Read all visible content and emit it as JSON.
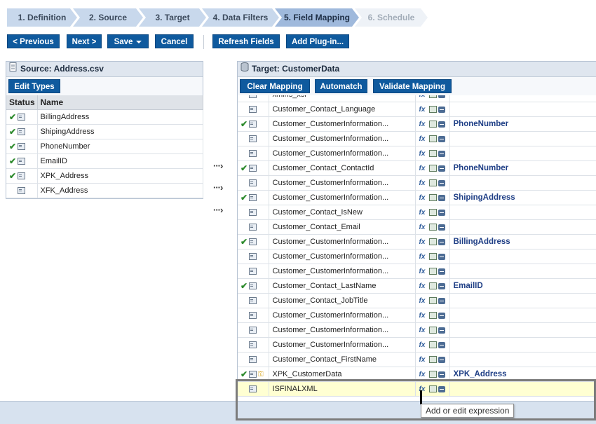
{
  "wizard": {
    "steps": [
      {
        "label": "1. Definition"
      },
      {
        "label": "2. Source"
      },
      {
        "label": "3. Target"
      },
      {
        "label": "4. Data Filters"
      },
      {
        "label": "5. Field Mapping"
      },
      {
        "label": "6. Schedule"
      }
    ],
    "active_step": "5. Field Mapping"
  },
  "toolbar": {
    "previous_label": "< Previous",
    "next_label": "Next >",
    "save_label": "Save",
    "cancel_label": "Cancel",
    "refresh_label": "Refresh Fields",
    "plugin_label": "Add Plug-in..."
  },
  "source": {
    "title": "Source: Address.csv",
    "edit_types_label": "Edit Types",
    "columns": {
      "status": "Status",
      "name": "Name"
    },
    "rows": [
      {
        "name": "BillingAddress",
        "mapped": true
      },
      {
        "name": "ShipingAddress",
        "mapped": true
      },
      {
        "name": "PhoneNumber",
        "mapped": true
      },
      {
        "name": "EmailID",
        "mapped": true
      },
      {
        "name": "XPK_Address",
        "mapped": true
      },
      {
        "name": "XFK_Address",
        "mapped": false
      }
    ]
  },
  "target": {
    "title": "Target: CustomerData",
    "clear_label": "Clear Mapping",
    "automatch_label": "Automatch",
    "validate_label": "Validate Mapping",
    "rows": [
      {
        "name": "xmlns_xsi",
        "mapped": "",
        "check": false
      },
      {
        "name": "Customer_Contact_Language",
        "mapped": "",
        "check": false
      },
      {
        "name": "Customer_CustomerInformation...",
        "mapped": "PhoneNumber",
        "check": true
      },
      {
        "name": "Customer_CustomerInformation...",
        "mapped": "",
        "check": false
      },
      {
        "name": "Customer_CustomerInformation...",
        "mapped": "",
        "check": false
      },
      {
        "name": "Customer_Contact_ContactId",
        "mapped": "PhoneNumber",
        "check": true
      },
      {
        "name": "Customer_CustomerInformation...",
        "mapped": "",
        "check": false
      },
      {
        "name": "Customer_CustomerInformation...",
        "mapped": "ShipingAddress",
        "check": true
      },
      {
        "name": "Customer_Contact_IsNew",
        "mapped": "",
        "check": false
      },
      {
        "name": "Customer_Contact_Email",
        "mapped": "",
        "check": false
      },
      {
        "name": "Customer_CustomerInformation...",
        "mapped": "BillingAddress",
        "check": true
      },
      {
        "name": "Customer_CustomerInformation...",
        "mapped": "",
        "check": false
      },
      {
        "name": "Customer_CustomerInformation...",
        "mapped": "",
        "check": false
      },
      {
        "name": "Customer_Contact_LastName",
        "mapped": "EmailID",
        "check": true
      },
      {
        "name": "Customer_Contact_JobTitle",
        "mapped": "",
        "check": false
      },
      {
        "name": "Customer_CustomerInformation...",
        "mapped": "",
        "check": false
      },
      {
        "name": "Customer_CustomerInformation...",
        "mapped": "",
        "check": false
      },
      {
        "name": "Customer_CustomerInformation...",
        "mapped": "",
        "check": false
      },
      {
        "name": "Customer_Contact_FirstName",
        "mapped": "",
        "check": false
      },
      {
        "name": "XPK_CustomerData",
        "mapped": "XPK_Address",
        "check": true,
        "key": true
      },
      {
        "name": "ISFINALXML",
        "mapped": "",
        "check": false,
        "highlight": true
      }
    ]
  },
  "tooltip": {
    "text": "Add or edit expression"
  },
  "icons": {
    "check": "check-icon",
    "row": "field-icon",
    "key": "key-icon",
    "expression": "fx-icon",
    "lookup": "lookup-icon",
    "remove": "remove-icon",
    "arrow": "map-arrow-icon"
  },
  "colors": {
    "button": "#0f5a9e",
    "mapped_text": "#1f3f86",
    "check": "#2e8b2e",
    "highlight_row": "#ffffd2"
  }
}
